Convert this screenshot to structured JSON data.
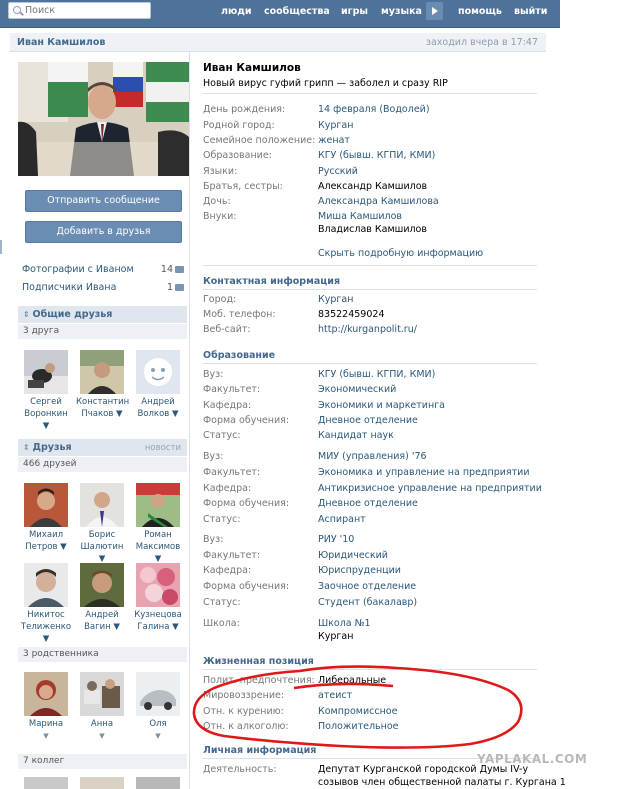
{
  "nav": {
    "search_placeholder": "Поиск",
    "items": [
      "люди",
      "сообщества",
      "игры",
      "музыка",
      "помощь",
      "выйти"
    ]
  },
  "header": {
    "name": "Иван Камшилов",
    "last_seen": "заходил вчера в 17:47"
  },
  "sidebar": {
    "send_message": "Отправить сообщение",
    "add_friend": "Добавить в друзья",
    "photos_label": "Фотографии с Иваном",
    "photos_count": "14",
    "subs_label": "Подписчики Ивана",
    "subs_count": "1",
    "common": {
      "title": "Общие друзья",
      "sub": "3 друга",
      "people": [
        {
          "first": "Сергей",
          "last": "Воронкин ▼"
        },
        {
          "first": "Константин",
          "last": "Пчаков ▼"
        },
        {
          "first": "Андрей",
          "last": "Волков ▼"
        }
      ]
    },
    "friends": {
      "title": "Друзья",
      "news": "новости",
      "sub": "466 друзей",
      "people": [
        {
          "first": "Михаил",
          "last": "Петров ▼"
        },
        {
          "first": "Борис",
          "last": "Шалютин ▼"
        },
        {
          "first": "Роман",
          "last": "Максимов ▼"
        },
        {
          "first": "Никитос",
          "last": "Телиженко ▼"
        },
        {
          "first": "Андрей",
          "last": "Вагин ▼"
        },
        {
          "first": "Кузнецова",
          "last": "Галина ▼"
        }
      ]
    },
    "relatives": {
      "sub": "3 родственника",
      "people": [
        {
          "first": "Марина",
          "last": "▼"
        },
        {
          "first": "Анна",
          "last": "▼"
        },
        {
          "first": "Оля",
          "last": "▼"
        }
      ]
    },
    "colleagues": {
      "sub": "7 коллег"
    }
  },
  "profile": {
    "name": "Иван Камшилов",
    "status": "Новый вирус гуфий грипп — заболел и сразу RIP",
    "basic": [
      {
        "label": "День рождения:",
        "value": "14 февраля (Водолей)"
      },
      {
        "label": "Родной город:",
        "value": "Курган"
      },
      {
        "label": "Семейное положение:",
        "value": "женат"
      },
      {
        "label": "Образование:",
        "value": "КГУ (бывш. КГПИ, КМИ)"
      },
      {
        "label": "Языки:",
        "value": "Русский"
      },
      {
        "label": "Братья, сестры:",
        "value": "Александр Камшилов"
      },
      {
        "label": "Дочь:",
        "value": "Александра Камшилова"
      },
      {
        "label": "Внуки:",
        "value": "Миша Камшилов"
      },
      {
        "label": "",
        "value": "Владислав Камшилов"
      }
    ],
    "hide_link": "Скрыть подробную информацию",
    "contact_title": "Контактная информация",
    "contacts": [
      {
        "label": "Город:",
        "value": "Курган"
      },
      {
        "label": "Моб. телефон:",
        "value": "83522459024"
      },
      {
        "label": "Веб-сайт:",
        "value": "http://kurganpolit.ru/"
      }
    ],
    "edu_title": "Образование",
    "edu": [
      {
        "label": "Вуз:",
        "value": "КГУ (бывш. КГПИ, КМИ)"
      },
      {
        "label": "Факультет:",
        "value": "Экономический"
      },
      {
        "label": "Кафедра:",
        "value": "Экономики и маркетинга"
      },
      {
        "label": "Форма обучения:",
        "value": "Дневное отделение"
      },
      {
        "label": "Статус:",
        "value": "Кандидат наук"
      },
      {
        "label": "Вуз:",
        "value": "МИУ (управления) '76"
      },
      {
        "label": "Факультет:",
        "value": "Экономика и управление на предприятии"
      },
      {
        "label": "Кафедра:",
        "value": "Антикризисное управление на предприятии"
      },
      {
        "label": "Форма обучения:",
        "value": "Дневное отделение"
      },
      {
        "label": "Статус:",
        "value": "Аспирант"
      },
      {
        "label": "Вуз:",
        "value": "РИУ '10"
      },
      {
        "label": "Факультет:",
        "value": "Юридический"
      },
      {
        "label": "Кафедра:",
        "value": "Юриспруденции"
      },
      {
        "label": "Форма обучения:",
        "value": "Заочное отделение"
      },
      {
        "label": "Статус:",
        "value": "Студент (бакалавр)"
      },
      {
        "label": "Школа:",
        "value": "Школа №1"
      },
      {
        "label": "",
        "value": "Курган"
      }
    ],
    "life_title": "Жизненная позиция",
    "life": [
      {
        "label": "Полит. предпочтения:",
        "value": "Либеральные"
      },
      {
        "label": "Мировоззрение:",
        "value": "атеист"
      },
      {
        "label": "Отн. к курению:",
        "value": "Компромиссное"
      },
      {
        "label": "Отн. к алкоголю:",
        "value": "Положительное"
      }
    ],
    "personal_title": "Личная информация",
    "activity_label": "Деятельность:",
    "activity_1": "Депутат Курганской городской Думы IV-у",
    "activity_2": "созывов член общественной палаты г. Кургана 1"
  },
  "watermark": "YAPLAKAL.COM"
}
